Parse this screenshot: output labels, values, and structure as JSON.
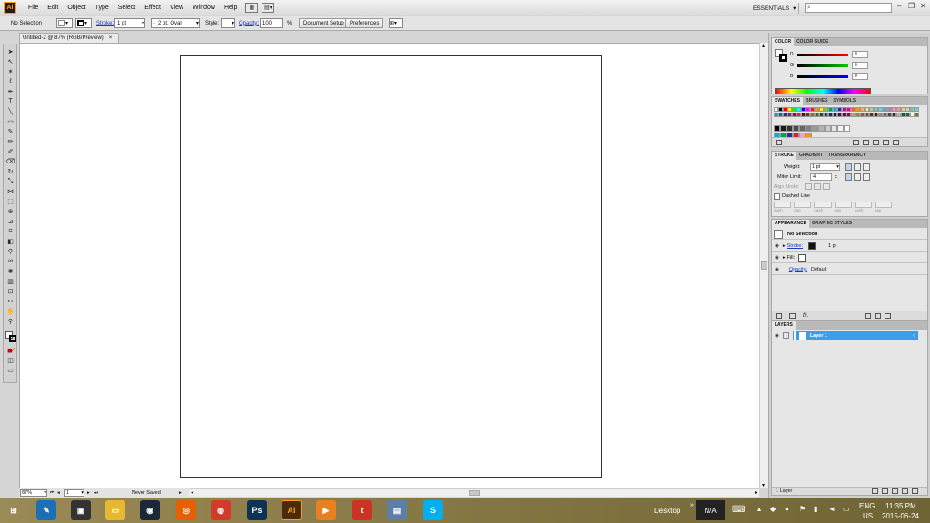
{
  "app": {
    "logo": "Ai"
  },
  "menu": [
    "File",
    "Edit",
    "Object",
    "Type",
    "Select",
    "Effect",
    "View",
    "Window",
    "Help"
  ],
  "workspace": {
    "label": "ESSENTIALS",
    "search_placeholder": ""
  },
  "control_bar": {
    "selection": "No Selection",
    "stroke_label": "Stroke:",
    "stroke_value": "1 pt",
    "brush": "2 pt. Oval",
    "style_label": "Style:",
    "opacity_label": "Opacity:",
    "opacity_value": "100",
    "opacity_unit": "%",
    "document_setup": "Document Setup",
    "preferences": "Preferences"
  },
  "document": {
    "tab_title": "Untitled-2 @ 87% (RGB/Preview)",
    "close": "×"
  },
  "status": {
    "zoom": "87%",
    "artboard": "1",
    "save_state": "Never Saved"
  },
  "color_panel": {
    "tabs": [
      "COLOR",
      "COLOR GUIDE"
    ],
    "channels": [
      {
        "label": "R",
        "value": "0",
        "color": "#cc0000"
      },
      {
        "label": "G",
        "value": "0",
        "color": "#00aa00"
      },
      {
        "label": "B",
        "value": "0",
        "color": "#0000cc"
      }
    ]
  },
  "swatches_panel": {
    "tabs": [
      "SWATCHES",
      "BRUSHES",
      "SYMBOLS"
    ],
    "row1": [
      "#ffffff",
      "#000000",
      "#ff0000",
      "#ffff00",
      "#00ff00",
      "#00ffff",
      "#0000ff",
      "#ff00ff",
      "#ed1c24",
      "#f7941d",
      "#fff200",
      "#8dc63f",
      "#00a651",
      "#00aeef",
      "#2e3192",
      "#92278f",
      "#ec008c",
      "#f26522",
      "#f7941d",
      "#fbaf5d",
      "#fff568",
      "#a3d39c",
      "#7accc8",
      "#6dcff6",
      "#8393ca",
      "#a186be",
      "#f49ac1",
      "#f5989d",
      "#fdc689",
      "#c4df9b",
      "#82ca9c",
      "#6ecff6"
    ],
    "row2": [
      "#00a99d",
      "#0072bc",
      "#2e3192",
      "#662d91",
      "#9e005d",
      "#ed145b",
      "#790000",
      "#7b2e00",
      "#827b00",
      "#406618",
      "#005e20",
      "#005952",
      "#003663",
      "#1b1464",
      "#440e62",
      "#630460",
      "#9e0039",
      "#c69c6d",
      "#a67c52",
      "#8c6239",
      "#754c24",
      "#603913",
      "#3c2415",
      "#998675",
      "#736357",
      "#534741",
      "#362f2d",
      "#c7b299",
      "#0a5e3b",
      "#176b44",
      "#ffffff",
      "#6d7d3b"
    ],
    "row3": [
      "#000000",
      "#1a1a1a",
      "#333333",
      "#4d4d4d",
      "#666666",
      "#808080",
      "#999999",
      "#b3b3b3",
      "#cccccc",
      "#e6e6e6",
      "#f2f2f2",
      "#ffffff"
    ],
    "row4": [
      "#00aeef",
      "#00a651",
      "#2e3192",
      "#ed1c24",
      "#ff99cc",
      "#f7941d"
    ]
  },
  "stroke_panel": {
    "tabs": [
      "STROKE",
      "GRADIENT",
      "TRANSPARENCY"
    ],
    "weight_label": "Weight:",
    "weight_value": "1 pt",
    "miter_label": "Miter Limit:",
    "miter_value": "4",
    "miter_unit": "x",
    "align_label": "Align Stroke:",
    "dashed_label": "Dashed Line",
    "dash_labels": [
      "dash",
      "gap",
      "dash",
      "gap",
      "dash",
      "gap"
    ]
  },
  "appearance_panel": {
    "tabs": [
      "APPEARANCE",
      "GRAPHIC STYLES"
    ],
    "title": "No Selection",
    "stroke_label": "Stroke:",
    "stroke_value": "1 pt",
    "fill_label": "Fill:",
    "opacity_label": "Opacity:",
    "opacity_value": "Default",
    "fx": "fx."
  },
  "layers_panel": {
    "tabs": [
      "LAYERS"
    ],
    "layer_name": "Layer 1",
    "footer": "1 Layer",
    "highlight_color": "#3c9ee8"
  },
  "taskbar": {
    "apps": [
      {
        "name": "start",
        "label": "⊞",
        "color": "#ffffff"
      },
      {
        "name": "app-blue",
        "label": "✎",
        "color": "#1b6fb5"
      },
      {
        "name": "media",
        "label": "▣",
        "color": "#333333"
      },
      {
        "name": "explorer",
        "label": "▭",
        "color": "#e8b730"
      },
      {
        "name": "steam",
        "label": "◉",
        "color": "#1b2838"
      },
      {
        "name": "firefox",
        "label": "◎",
        "color": "#e66000"
      },
      {
        "name": "chrome",
        "label": "◍",
        "color": "#d23a2a"
      },
      {
        "name": "photoshop",
        "label": "Ps",
        "color": "#0d3354"
      },
      {
        "name": "illustrator",
        "label": "Ai",
        "color": "#4b2a0e"
      },
      {
        "name": "player",
        "label": "▶",
        "color": "#e88020"
      },
      {
        "name": "tumblr",
        "label": "t",
        "color": "#cc3322"
      },
      {
        "name": "files",
        "label": "▤",
        "color": "#5a7fa8"
      },
      {
        "name": "skype",
        "label": "S",
        "color": "#00aff0"
      }
    ],
    "desktop": "Desktop",
    "na": "N/A",
    "language": "ENG",
    "region": "US",
    "time": "11:35 PM",
    "date": "2015-06-24"
  }
}
